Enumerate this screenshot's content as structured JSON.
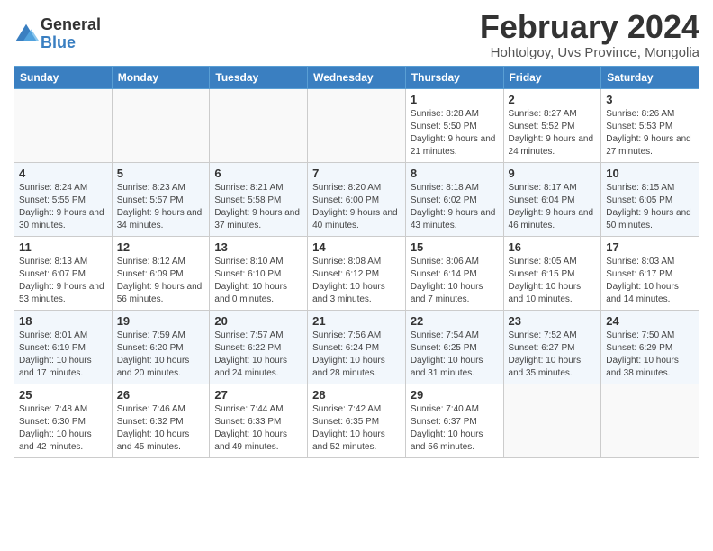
{
  "logo": {
    "general": "General",
    "blue": "Blue"
  },
  "title": "February 2024",
  "location": "Hohtolgoy, Uvs Province, Mongolia",
  "headers": [
    "Sunday",
    "Monday",
    "Tuesday",
    "Wednesday",
    "Thursday",
    "Friday",
    "Saturday"
  ],
  "weeks": [
    [
      {
        "day": "",
        "info": ""
      },
      {
        "day": "",
        "info": ""
      },
      {
        "day": "",
        "info": ""
      },
      {
        "day": "",
        "info": ""
      },
      {
        "day": "1",
        "info": "Sunrise: 8:28 AM\nSunset: 5:50 PM\nDaylight: 9 hours and 21 minutes."
      },
      {
        "day": "2",
        "info": "Sunrise: 8:27 AM\nSunset: 5:52 PM\nDaylight: 9 hours and 24 minutes."
      },
      {
        "day": "3",
        "info": "Sunrise: 8:26 AM\nSunset: 5:53 PM\nDaylight: 9 hours and 27 minutes."
      }
    ],
    [
      {
        "day": "4",
        "info": "Sunrise: 8:24 AM\nSunset: 5:55 PM\nDaylight: 9 hours and 30 minutes."
      },
      {
        "day": "5",
        "info": "Sunrise: 8:23 AM\nSunset: 5:57 PM\nDaylight: 9 hours and 34 minutes."
      },
      {
        "day": "6",
        "info": "Sunrise: 8:21 AM\nSunset: 5:58 PM\nDaylight: 9 hours and 37 minutes."
      },
      {
        "day": "7",
        "info": "Sunrise: 8:20 AM\nSunset: 6:00 PM\nDaylight: 9 hours and 40 minutes."
      },
      {
        "day": "8",
        "info": "Sunrise: 8:18 AM\nSunset: 6:02 PM\nDaylight: 9 hours and 43 minutes."
      },
      {
        "day": "9",
        "info": "Sunrise: 8:17 AM\nSunset: 6:04 PM\nDaylight: 9 hours and 46 minutes."
      },
      {
        "day": "10",
        "info": "Sunrise: 8:15 AM\nSunset: 6:05 PM\nDaylight: 9 hours and 50 minutes."
      }
    ],
    [
      {
        "day": "11",
        "info": "Sunrise: 8:13 AM\nSunset: 6:07 PM\nDaylight: 9 hours and 53 minutes."
      },
      {
        "day": "12",
        "info": "Sunrise: 8:12 AM\nSunset: 6:09 PM\nDaylight: 9 hours and 56 minutes."
      },
      {
        "day": "13",
        "info": "Sunrise: 8:10 AM\nSunset: 6:10 PM\nDaylight: 10 hours and 0 minutes."
      },
      {
        "day": "14",
        "info": "Sunrise: 8:08 AM\nSunset: 6:12 PM\nDaylight: 10 hours and 3 minutes."
      },
      {
        "day": "15",
        "info": "Sunrise: 8:06 AM\nSunset: 6:14 PM\nDaylight: 10 hours and 7 minutes."
      },
      {
        "day": "16",
        "info": "Sunrise: 8:05 AM\nSunset: 6:15 PM\nDaylight: 10 hours and 10 minutes."
      },
      {
        "day": "17",
        "info": "Sunrise: 8:03 AM\nSunset: 6:17 PM\nDaylight: 10 hours and 14 minutes."
      }
    ],
    [
      {
        "day": "18",
        "info": "Sunrise: 8:01 AM\nSunset: 6:19 PM\nDaylight: 10 hours and 17 minutes."
      },
      {
        "day": "19",
        "info": "Sunrise: 7:59 AM\nSunset: 6:20 PM\nDaylight: 10 hours and 20 minutes."
      },
      {
        "day": "20",
        "info": "Sunrise: 7:57 AM\nSunset: 6:22 PM\nDaylight: 10 hours and 24 minutes."
      },
      {
        "day": "21",
        "info": "Sunrise: 7:56 AM\nSunset: 6:24 PM\nDaylight: 10 hours and 28 minutes."
      },
      {
        "day": "22",
        "info": "Sunrise: 7:54 AM\nSunset: 6:25 PM\nDaylight: 10 hours and 31 minutes."
      },
      {
        "day": "23",
        "info": "Sunrise: 7:52 AM\nSunset: 6:27 PM\nDaylight: 10 hours and 35 minutes."
      },
      {
        "day": "24",
        "info": "Sunrise: 7:50 AM\nSunset: 6:29 PM\nDaylight: 10 hours and 38 minutes."
      }
    ],
    [
      {
        "day": "25",
        "info": "Sunrise: 7:48 AM\nSunset: 6:30 PM\nDaylight: 10 hours and 42 minutes."
      },
      {
        "day": "26",
        "info": "Sunrise: 7:46 AM\nSunset: 6:32 PM\nDaylight: 10 hours and 45 minutes."
      },
      {
        "day": "27",
        "info": "Sunrise: 7:44 AM\nSunset: 6:33 PM\nDaylight: 10 hours and 49 minutes."
      },
      {
        "day": "28",
        "info": "Sunrise: 7:42 AM\nSunset: 6:35 PM\nDaylight: 10 hours and 52 minutes."
      },
      {
        "day": "29",
        "info": "Sunrise: 7:40 AM\nSunset: 6:37 PM\nDaylight: 10 hours and 56 minutes."
      },
      {
        "day": "",
        "info": ""
      },
      {
        "day": "",
        "info": ""
      }
    ]
  ]
}
